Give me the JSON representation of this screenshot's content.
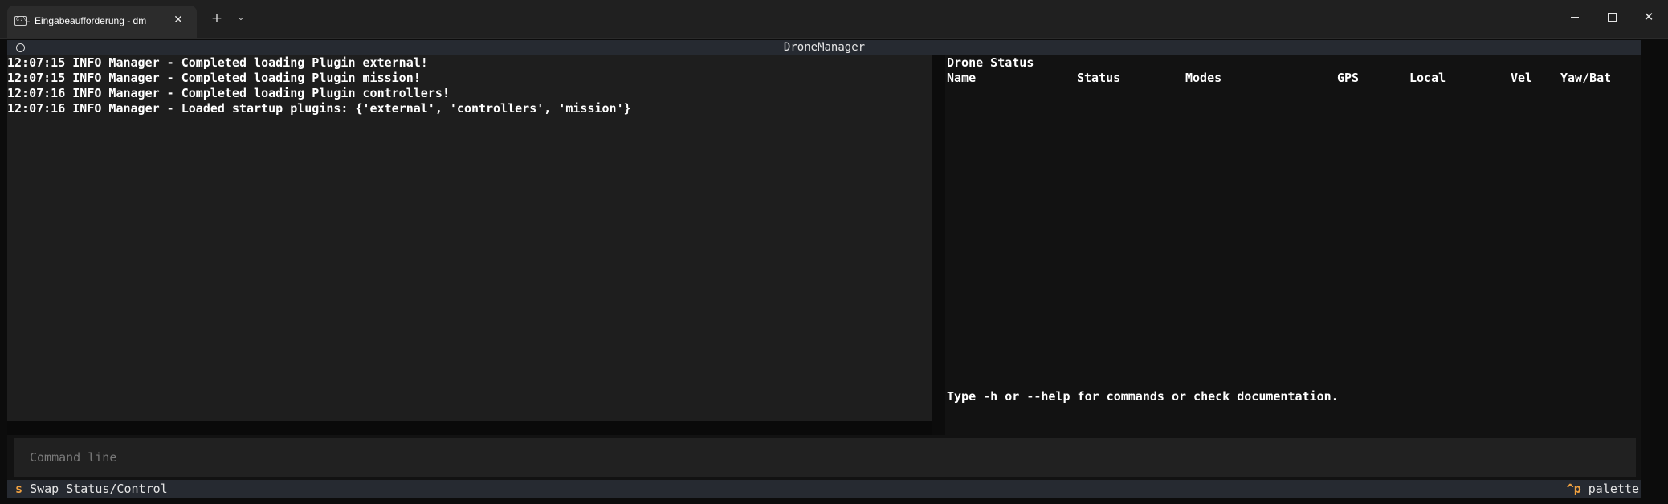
{
  "window": {
    "tab_title": "Eingabeaufforderung - dm",
    "tab_icon_text": "C:\\_",
    "close_tab_glyph": "✕",
    "new_tab_glyph": "+",
    "dropdown_glyph": "⌄",
    "close_window_glyph": "✕"
  },
  "app": {
    "title": "DroneManager"
  },
  "log": {
    "lines": [
      "12:07:15 INFO Manager - Completed loading Plugin external!",
      "12:07:15 INFO Manager - Completed loading Plugin mission!",
      "12:07:16 INFO Manager - Completed loading Plugin controllers!",
      "12:07:16 INFO Manager - Loaded startup plugins: {'external', 'controllers', 'mission'}"
    ]
  },
  "status": {
    "heading": "Drone Status",
    "columns": [
      "Name",
      "Status",
      "Modes",
      "GPS",
      "Local",
      "Vel",
      "Yaw/Bat"
    ],
    "help_text": "Type -h or --help for commands or check documentation."
  },
  "command": {
    "placeholder": "Command line",
    "value": ""
  },
  "footer": {
    "left_key": "s",
    "left_label": "Swap Status/Control",
    "right_key": "^p",
    "right_label": "palette"
  },
  "colors": {
    "terminal_bg": "#0c0c0c",
    "header_bg": "#262a31",
    "log_bg": "#1e1e1e",
    "status_bg": "#121212",
    "key_accent": "#f0a140"
  }
}
